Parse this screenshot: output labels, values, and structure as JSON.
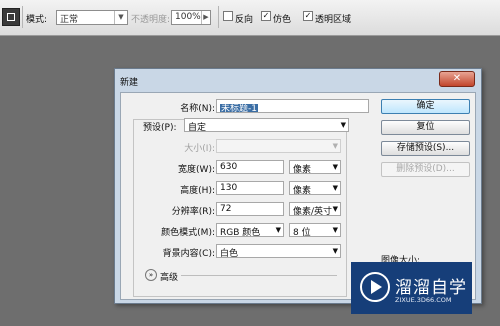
{
  "optionsbar": {
    "mode_label": "模式:",
    "mode_value": "正常",
    "opacity_label": "不透明度:",
    "opacity_value": "100%",
    "reverse_label": "反向",
    "dither_label": "仿色",
    "transparency_label": "透明区域",
    "reverse_checked": false,
    "dither_checked": true,
    "transparency_checked": true
  },
  "dialog": {
    "title": "新建",
    "close_symbol": "✕",
    "name_label": "名称(N):",
    "name_value": "未标题-1",
    "preset_label": "预设(P):",
    "preset_value": "自定",
    "size_label": "大小(I):",
    "size_value": "",
    "width_label": "宽度(W):",
    "width_value": "630",
    "width_unit": "像素",
    "height_label": "高度(H):",
    "height_value": "130",
    "height_unit": "像素",
    "resolution_label": "分辨率(R):",
    "resolution_value": "72",
    "resolution_unit": "像素/英寸",
    "color_mode_label": "颜色模式(M):",
    "color_mode_value": "RGB 颜色",
    "bit_depth_value": "8 位",
    "background_label": "背景内容(C):",
    "background_value": "白色",
    "advanced_label": "高级",
    "image_size_label": "图像大小:",
    "buttons": {
      "ok": "确定",
      "reset": "复位",
      "save_preset": "存储预设(S)...",
      "delete_preset": "删除预设(D)..."
    }
  },
  "watermark": {
    "title": "溜溜自学",
    "url": "ZIXUE.3D66.COM"
  },
  "colors": {
    "canvas": "#6e6e6e",
    "dialog_frame": "#c9d7e6",
    "close_button": "#c2452b",
    "selection": "#3b6ea5",
    "watermark_bg": "#163e79"
  }
}
